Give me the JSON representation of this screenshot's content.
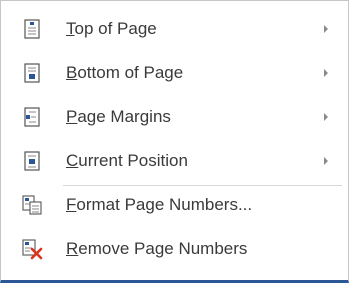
{
  "menu": {
    "items": [
      {
        "key": "T",
        "rest": "op of Page",
        "has_submenu": true,
        "icon": "page-top-icon"
      },
      {
        "key": "B",
        "rest": "ottom of Page",
        "has_submenu": true,
        "icon": "page-bottom-icon"
      },
      {
        "key": "P",
        "rest": "age Margins",
        "has_submenu": true,
        "icon": "page-margins-icon"
      },
      {
        "key": "C",
        "rest": "urrent Position",
        "has_submenu": true,
        "icon": "current-position-icon"
      },
      {
        "key": "F",
        "rest": "ormat Page Numbers...",
        "has_submenu": false,
        "icon": "format-page-numbers-icon"
      },
      {
        "key": "R",
        "rest": "emove Page Numbers",
        "has_submenu": false,
        "icon": "remove-page-numbers-icon"
      }
    ]
  },
  "colors": {
    "accent_blue": "#2b5797",
    "remove_red": "#d9341c",
    "text": "#3a3a3a"
  }
}
